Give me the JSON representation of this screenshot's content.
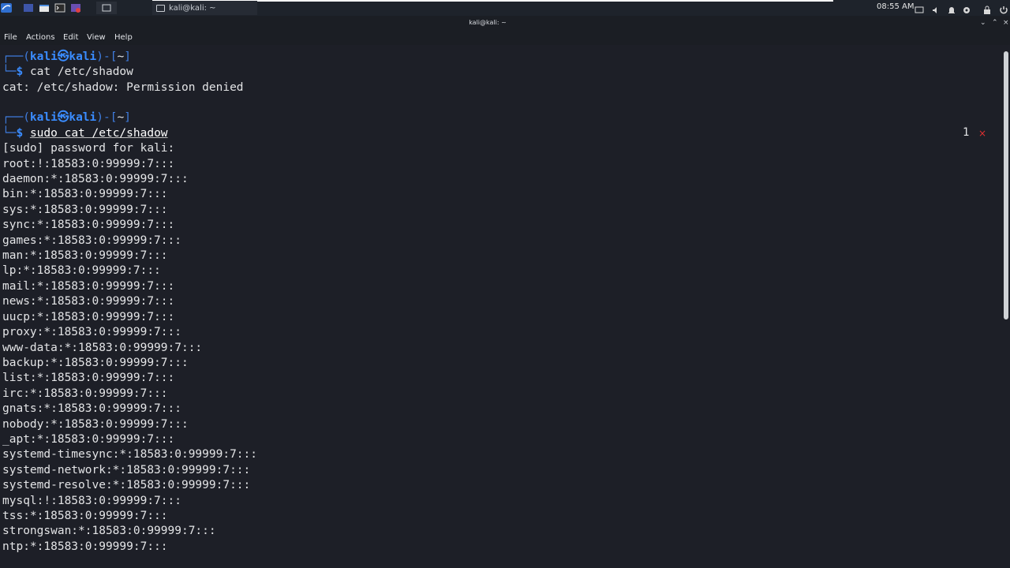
{
  "taskbar": {
    "task_window_title": "kali@kali: ~",
    "clock": "08:55 AM"
  },
  "window": {
    "title": "kali@kali: ~"
  },
  "menu": {
    "items": [
      "File",
      "Actions",
      "Edit",
      "View",
      "Help"
    ]
  },
  "terminal": {
    "prompt": {
      "frame_top": "┌──(",
      "user_host": "kali㉿kali",
      "frame_mid": ")-[",
      "dir": "~",
      "frame_end": "]",
      "frame_bottom": "└─",
      "symbol": "$"
    },
    "commands": [
      "cat /etc/shadow",
      "sudo cat /etc/shadow"
    ],
    "outputs": {
      "first": [
        "cat: /etc/shadow: Permission denied"
      ],
      "second": [
        "[sudo] password for kali:",
        "root:!:18583:0:99999:7:::",
        "daemon:*:18583:0:99999:7:::",
        "bin:*:18583:0:99999:7:::",
        "sys:*:18583:0:99999:7:::",
        "sync:*:18583:0:99999:7:::",
        "games:*:18583:0:99999:7:::",
        "man:*:18583:0:99999:7:::",
        "lp:*:18583:0:99999:7:::",
        "mail:*:18583:0:99999:7:::",
        "news:*:18583:0:99999:7:::",
        "uucp:*:18583:0:99999:7:::",
        "proxy:*:18583:0:99999:7:::",
        "www-data:*:18583:0:99999:7:::",
        "backup:*:18583:0:99999:7:::",
        "list:*:18583:0:99999:7:::",
        "irc:*:18583:0:99999:7:::",
        "gnats:*:18583:0:99999:7:::",
        "nobody:*:18583:0:99999:7:::",
        "_apt:*:18583:0:99999:7:::",
        "systemd-timesync:*:18583:0:99999:7:::",
        "systemd-network:*:18583:0:99999:7:::",
        "systemd-resolve:*:18583:0:99999:7:::",
        "mysql:!:18583:0:99999:7:::",
        "tss:*:18583:0:99999:7:::",
        "strongswan:*:18583:0:99999:7:::",
        "ntp:*:18583:0:99999:7:::"
      ]
    },
    "badge": {
      "count": "1",
      "close_symbol": "×"
    }
  },
  "colors": {
    "terminal_bg": "#1d1f27",
    "prompt_blue": "#3a8cff",
    "text": "#e3e4e6",
    "badge_red": "#e03030"
  }
}
